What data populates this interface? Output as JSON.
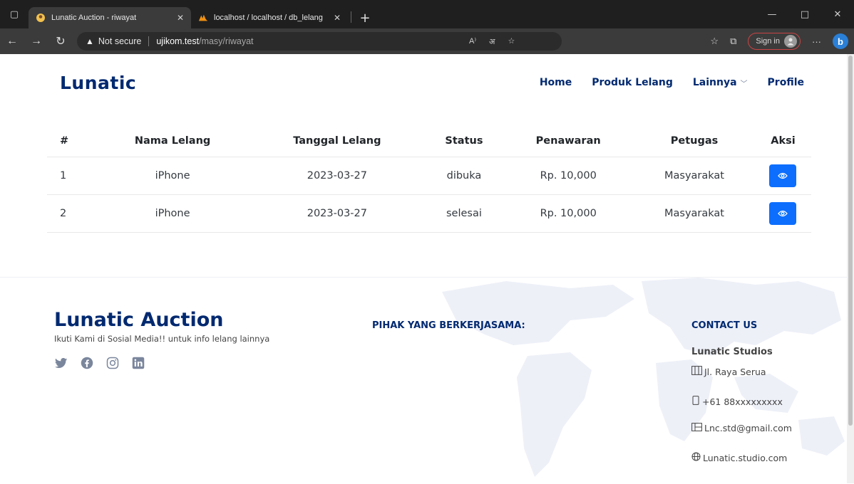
{
  "browser": {
    "tabs": [
      {
        "title": "Lunatic Auction - riwayat",
        "active": true
      },
      {
        "title": "localhost / localhost / db_lelang",
        "active": false
      }
    ],
    "security_label": "Not secure",
    "url_host": "ujikom.test",
    "url_path": "/masy/riwayat",
    "signin_label": "Sign in"
  },
  "navbar": {
    "brand": "Lunatic",
    "menu": [
      {
        "label": "Home"
      },
      {
        "label": "Produk Lelang"
      },
      {
        "label": "Lainnya"
      },
      {
        "label": "Profile"
      }
    ]
  },
  "table": {
    "headers": [
      "#",
      "Nama Lelang",
      "Tanggal Lelang",
      "Status",
      "Penawaran",
      "Petugas",
      "Aksi"
    ],
    "rows": [
      {
        "no": "1",
        "nama": "iPhone",
        "tanggal": "2023-03-27",
        "status": "dibuka",
        "penawaran": "Rp. 10,000",
        "petugas": "Masyarakat"
      },
      {
        "no": "2",
        "nama": "iPhone",
        "tanggal": "2023-03-27",
        "status": "selesai",
        "penawaran": "Rp. 10,000",
        "petugas": "Masyarakat"
      }
    ]
  },
  "footer": {
    "brand": "Lunatic Auction",
    "tagline": "Ikuti Kami di Sosial Media!! untuk info lelang lainnya",
    "socials": [
      "twitter-icon",
      "facebook-icon",
      "instagram-icon",
      "linkedin-icon"
    ],
    "partner_heading": "PIHAK YANG BERKERJASAMA:",
    "contact_heading": "CONTACT US",
    "company": "Lunatic Studios",
    "address": "Jl. Raya Serua",
    "phone": "+61 88xxxxxxxxx",
    "email": "Lnc.std@gmail.com",
    "website": "Lunatic.studio.com"
  },
  "colors": {
    "brand": "#012970",
    "primary_button": "#0d6efd"
  }
}
